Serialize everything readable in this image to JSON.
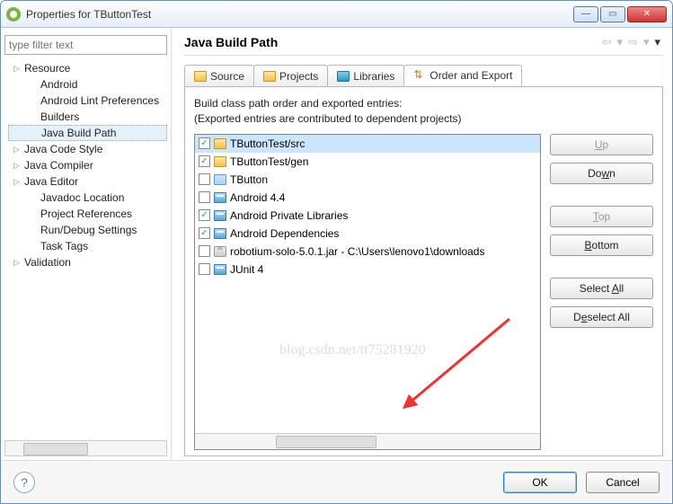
{
  "window": {
    "title": "Properties for TButtonTest"
  },
  "filter_placeholder": "type filter text",
  "tree": [
    {
      "label": "Resource",
      "expandable": true
    },
    {
      "label": "Android",
      "indent": 1
    },
    {
      "label": "Android Lint Preferences",
      "indent": 1
    },
    {
      "label": "Builders",
      "indent": 1
    },
    {
      "label": "Java Build Path",
      "indent": 1,
      "selected": true
    },
    {
      "label": "Java Code Style",
      "expandable": true
    },
    {
      "label": "Java Compiler",
      "expandable": true
    },
    {
      "label": "Java Editor",
      "expandable": true
    },
    {
      "label": "Javadoc Location",
      "indent": 1
    },
    {
      "label": "Project References",
      "indent": 1
    },
    {
      "label": "Run/Debug Settings",
      "indent": 1
    },
    {
      "label": "Task Tags",
      "indent": 1
    },
    {
      "label": "Validation",
      "expandable": true
    }
  ],
  "main": {
    "title": "Java Build Path",
    "desc_line1": "Build class path order and exported entries:",
    "desc_line2": "(Exported entries are contributed to dependent projects)"
  },
  "tabs": [
    {
      "label": "Source",
      "icon": "folder"
    },
    {
      "label": "Projects",
      "icon": "folder"
    },
    {
      "label": "Libraries",
      "icon": "lib"
    },
    {
      "label": "Order and Export",
      "icon": "arrows",
      "active": true
    }
  ],
  "entries": [
    {
      "checked": true,
      "icon": "pkg",
      "label": "TButtonTest/src",
      "selected": true
    },
    {
      "checked": true,
      "icon": "pkg",
      "label": "TButtonTest/gen"
    },
    {
      "checked": false,
      "icon": "folder2",
      "label": "TButton"
    },
    {
      "checked": false,
      "icon": "libstack",
      "label": "Android 4.4"
    },
    {
      "checked": true,
      "icon": "libstack",
      "label": "Android Private Libraries"
    },
    {
      "checked": true,
      "icon": "libstack",
      "label": "Android Dependencies"
    },
    {
      "checked": false,
      "icon": "jar",
      "label": "robotium-solo-5.0.1.jar - C:\\Users\\lenovo1\\downloads"
    },
    {
      "checked": false,
      "icon": "libstack",
      "label": "JUnit 4"
    }
  ],
  "buttons": {
    "up": "Up",
    "down": "Down",
    "top": "Top",
    "bottom": "Bottom",
    "select_all": "Select All",
    "deselect_all": "Deselect All"
  },
  "footer": {
    "ok": "OK",
    "cancel": "Cancel"
  },
  "watermark": "blog.csdn.net/tt75281920"
}
